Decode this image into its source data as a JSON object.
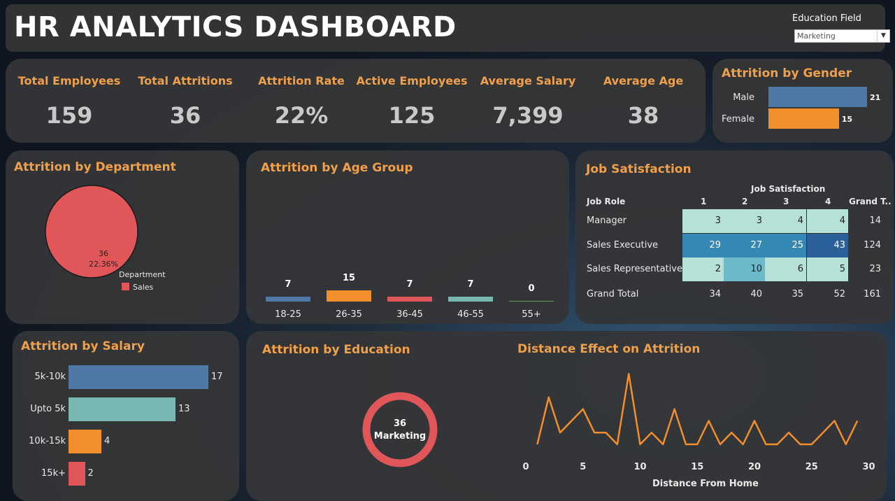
{
  "header": {
    "title": "HR ANALYTICS DASHBOARD",
    "filter_label": "Education Field",
    "filter_value": "Marketing"
  },
  "kpis": [
    {
      "label": "Total Employees",
      "value": "159"
    },
    {
      "label": "Total Attritions",
      "value": "36"
    },
    {
      "label": "Attrition Rate",
      "value": "22%"
    },
    {
      "label": "Active Employees",
      "value": "125"
    },
    {
      "label": "Average Salary",
      "value": "7,399"
    },
    {
      "label": "Average Age",
      "value": "38"
    }
  ],
  "colors": {
    "accent": "#f0a04b",
    "blue": "#4e79a7",
    "orange": "#f28e2b",
    "red": "#e15759",
    "teal": "#76b7b2",
    "green": "#59a14f"
  },
  "chart_data": [
    {
      "id": "gender",
      "type": "bar",
      "orientation": "horizontal",
      "title": "Attrition by Gender",
      "categories": [
        "Male",
        "Female"
      ],
      "values": [
        21,
        15
      ],
      "value_labels": [
        "21",
        "15"
      ],
      "colors": [
        "#4e79a7",
        "#f28e2b"
      ]
    },
    {
      "id": "department",
      "type": "pie",
      "title": "Attrition by Department",
      "legend_title": "Department",
      "legend_position": "bottom-right",
      "slices": [
        {
          "name": "Sales",
          "value": 36,
          "percent": "22.36%",
          "color": "#e15759"
        }
      ],
      "label_value": "36",
      "label_percent": "22.36%"
    },
    {
      "id": "age_group",
      "type": "bar",
      "title": "Attrition by Age Group",
      "categories": [
        "18-25",
        "26-35",
        "36-45",
        "46-55",
        "55+"
      ],
      "values": [
        7,
        15,
        7,
        7,
        0
      ],
      "value_labels": [
        "7",
        "15",
        "7",
        "7",
        "0"
      ],
      "colors": [
        "#4e79a7",
        "#f28e2b",
        "#e15759",
        "#76b7b2",
        "#59a14f"
      ]
    },
    {
      "id": "job_satisfaction",
      "type": "heatmap",
      "title": "Job Satisfaction",
      "column_header": "Job Satisfaction",
      "row_header": "Job Role",
      "columns": [
        "1",
        "2",
        "3",
        "4"
      ],
      "total_label": "Grand T..",
      "rows": [
        {
          "label": "Manager",
          "values": [
            3,
            3,
            4,
            4
          ],
          "total": 14
        },
        {
          "label": "Sales Executive",
          "values": [
            29,
            27,
            25,
            43
          ],
          "total": 124
        },
        {
          "label": "Sales Representative",
          "values": [
            2,
            10,
            6,
            5
          ],
          "total": 23
        }
      ],
      "grand_total": {
        "label": "Grand Total",
        "values": [
          34,
          40,
          35,
          52
        ],
        "total": 161
      }
    },
    {
      "id": "salary",
      "type": "bar",
      "orientation": "horizontal",
      "title": "Attrition by Salary",
      "categories": [
        "5k-10k",
        "Upto 5k",
        "10k-15k",
        "15k+"
      ],
      "values": [
        17,
        13,
        4,
        2
      ],
      "value_labels": [
        "17",
        "13",
        "4",
        "2"
      ],
      "colors": [
        "#4e79a7",
        "#76b7b2",
        "#f28e2b",
        "#e15759"
      ]
    },
    {
      "id": "education",
      "type": "pie",
      "style": "donut",
      "title": "Attrition by Education",
      "slices": [
        {
          "name": "Marketing",
          "value": 36,
          "color": "#e15759"
        }
      ],
      "center_value": "36",
      "center_label": "Marketing"
    },
    {
      "id": "distance",
      "type": "line",
      "title": "Distance Effect on Attrition",
      "xlabel": "Distance From Home",
      "xlim": [
        0,
        30
      ],
      "xticks": [
        "0",
        "5",
        "10",
        "15",
        "20",
        "25",
        "30"
      ],
      "x": [
        1,
        2,
        3,
        5,
        6,
        7,
        8,
        9,
        10,
        11,
        12,
        13,
        14,
        15,
        16,
        17,
        18,
        19,
        20,
        21,
        22,
        23,
        24,
        25,
        26,
        27,
        28,
        29
      ],
      "y": [
        1,
        5,
        2,
        4,
        2,
        2,
        1,
        7,
        1,
        2,
        1,
        4,
        1,
        1,
        3,
        1,
        2,
        1,
        3,
        1,
        1,
        2,
        1,
        1,
        2,
        3,
        1,
        3
      ],
      "y_note_unlabeled": true,
      "color": "#f28e2b"
    }
  ]
}
